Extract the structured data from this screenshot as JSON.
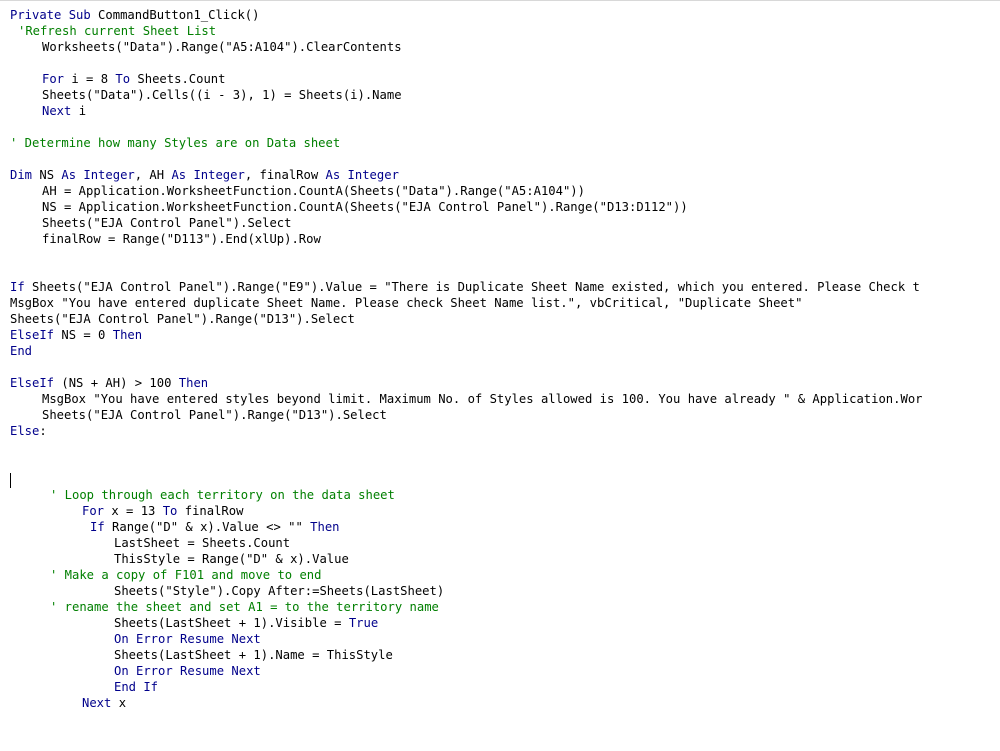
{
  "colors": {
    "keyword": "#00008b",
    "comment": "#007f00",
    "text": "#000000"
  },
  "editor": {
    "lines": [
      {
        "indent": 0,
        "tokens": [
          {
            "t": "k",
            "v": "Private Sub"
          },
          {
            "t": "n",
            "v": " CommandButton1_Click()"
          }
        ]
      },
      {
        "indent": 1,
        "tokens": [
          {
            "t": "c",
            "v": "'Refresh current Sheet List"
          }
        ]
      },
      {
        "indent": 4,
        "tokens": [
          {
            "t": "n",
            "v": "Worksheets(\"Data\").Range(\"A5:A104\").ClearContents"
          }
        ]
      },
      {
        "indent": 0,
        "tokens": []
      },
      {
        "indent": 4,
        "tokens": [
          {
            "t": "k",
            "v": "For"
          },
          {
            "t": "n",
            "v": " i = 8 "
          },
          {
            "t": "k",
            "v": "To"
          },
          {
            "t": "n",
            "v": " Sheets.Count"
          }
        ]
      },
      {
        "indent": 4,
        "tokens": [
          {
            "t": "n",
            "v": "Sheets(\"Data\").Cells((i - 3), 1) = Sheets(i).Name"
          }
        ]
      },
      {
        "indent": 4,
        "tokens": [
          {
            "t": "k",
            "v": "Next"
          },
          {
            "t": "n",
            "v": " i"
          }
        ]
      },
      {
        "indent": 0,
        "tokens": []
      },
      {
        "indent": 0,
        "tokens": [
          {
            "t": "c",
            "v": "' Determine how many Styles are on Data sheet"
          }
        ]
      },
      {
        "indent": 0,
        "tokens": []
      },
      {
        "indent": 0,
        "tokens": [
          {
            "t": "k",
            "v": "Dim"
          },
          {
            "t": "n",
            "v": " NS "
          },
          {
            "t": "k",
            "v": "As Integer"
          },
          {
            "t": "n",
            "v": ", AH "
          },
          {
            "t": "k",
            "v": "As Integer"
          },
          {
            "t": "n",
            "v": ", finalRow "
          },
          {
            "t": "k",
            "v": "As Integer"
          }
        ]
      },
      {
        "indent": 4,
        "tokens": [
          {
            "t": "n",
            "v": "AH = Application.WorksheetFunction.CountA(Sheets(\"Data\").Range(\"A5:A104\"))"
          }
        ]
      },
      {
        "indent": 4,
        "tokens": [
          {
            "t": "n",
            "v": "NS = Application.WorksheetFunction.CountA(Sheets(\"EJA Control Panel\").Range(\"D13:D112\"))"
          }
        ]
      },
      {
        "indent": 4,
        "tokens": [
          {
            "t": "n",
            "v": "Sheets(\"EJA Control Panel\").Select"
          }
        ]
      },
      {
        "indent": 4,
        "tokens": [
          {
            "t": "n",
            "v": "finalRow = Range(\"D113\").End(xlUp).Row"
          }
        ]
      },
      {
        "indent": 0,
        "tokens": []
      },
      {
        "indent": 0,
        "tokens": []
      },
      {
        "indent": 0,
        "tokens": [
          {
            "t": "k",
            "v": "If"
          },
          {
            "t": "n",
            "v": " Sheets(\"EJA Control Panel\").Range(\"E9\").Value = \"There is Duplicate Sheet Name existed, which you entered. Please Check t"
          }
        ]
      },
      {
        "indent": 0,
        "tokens": [
          {
            "t": "n",
            "v": "MsgBox \"You have entered duplicate Sheet Name. Please check Sheet Name list.\", vbCritical, \"Duplicate Sheet\""
          }
        ]
      },
      {
        "indent": 0,
        "tokens": [
          {
            "t": "n",
            "v": "Sheets(\"EJA Control Panel\").Range(\"D13\").Select"
          }
        ]
      },
      {
        "indent": 0,
        "tokens": [
          {
            "t": "k",
            "v": "ElseIf"
          },
          {
            "t": "n",
            "v": " NS = 0 "
          },
          {
            "t": "k",
            "v": "Then"
          }
        ]
      },
      {
        "indent": 0,
        "tokens": [
          {
            "t": "k",
            "v": "End"
          }
        ]
      },
      {
        "indent": 0,
        "tokens": []
      },
      {
        "indent": 0,
        "tokens": [
          {
            "t": "k",
            "v": "ElseIf"
          },
          {
            "t": "n",
            "v": " (NS + AH) > 100 "
          },
          {
            "t": "k",
            "v": "Then"
          }
        ]
      },
      {
        "indent": 4,
        "tokens": [
          {
            "t": "n",
            "v": "MsgBox \"You have entered styles beyond limit. Maximum No. of Styles allowed is 100. You have already \" & Application.Wor"
          }
        ]
      },
      {
        "indent": 4,
        "tokens": [
          {
            "t": "n",
            "v": "Sheets(\"EJA Control Panel\").Range(\"D13\").Select"
          }
        ]
      },
      {
        "indent": 0,
        "tokens": [
          {
            "t": "k",
            "v": "Else"
          },
          {
            "t": "n",
            "v": ":"
          }
        ]
      },
      {
        "indent": 0,
        "tokens": []
      },
      {
        "indent": 0,
        "tokens": []
      },
      {
        "indent": 0,
        "tokens": []
      },
      {
        "indent": 5,
        "tokens": [
          {
            "t": "c",
            "v": "' Loop through each territory on the data sheet"
          }
        ]
      },
      {
        "indent": 9,
        "tokens": [
          {
            "t": "k",
            "v": "For"
          },
          {
            "t": "n",
            "v": " x = 13 "
          },
          {
            "t": "k",
            "v": "To"
          },
          {
            "t": "n",
            "v": " finalRow"
          }
        ]
      },
      {
        "indent": 10,
        "tokens": [
          {
            "t": "k",
            "v": "If"
          },
          {
            "t": "n",
            "v": " Range(\"D\" & x).Value <> \"\" "
          },
          {
            "t": "k",
            "v": "Then"
          }
        ]
      },
      {
        "indent": 13,
        "tokens": [
          {
            "t": "n",
            "v": "LastSheet = Sheets.Count"
          }
        ]
      },
      {
        "indent": 13,
        "tokens": [
          {
            "t": "n",
            "v": "ThisStyle = Range(\"D\" & x).Value"
          }
        ]
      },
      {
        "indent": 5,
        "tokens": [
          {
            "t": "c",
            "v": "' Make a copy of F101 and move to end"
          }
        ]
      },
      {
        "indent": 13,
        "tokens": [
          {
            "t": "n",
            "v": "Sheets(\"Style\").Copy After:=Sheets(LastSheet)"
          }
        ]
      },
      {
        "indent": 5,
        "tokens": [
          {
            "t": "c",
            "v": "' rename the sheet and set A1 = to the territory name"
          }
        ]
      },
      {
        "indent": 13,
        "tokens": [
          {
            "t": "n",
            "v": "Sheets(LastSheet + 1).Visible = "
          },
          {
            "t": "k",
            "v": "True"
          }
        ]
      },
      {
        "indent": 13,
        "tokens": [
          {
            "t": "k",
            "v": "On Error Resume Next"
          }
        ]
      },
      {
        "indent": 13,
        "tokens": [
          {
            "t": "n",
            "v": "Sheets(LastSheet + 1).Name = ThisStyle"
          }
        ]
      },
      {
        "indent": 13,
        "tokens": [
          {
            "t": "k",
            "v": "On Error Resume Next"
          }
        ]
      },
      {
        "indent": 13,
        "tokens": [
          {
            "t": "k",
            "v": "End If"
          }
        ]
      },
      {
        "indent": 9,
        "tokens": [
          {
            "t": "k",
            "v": "Next"
          },
          {
            "t": "n",
            "v": " x"
          }
        ]
      }
    ]
  }
}
